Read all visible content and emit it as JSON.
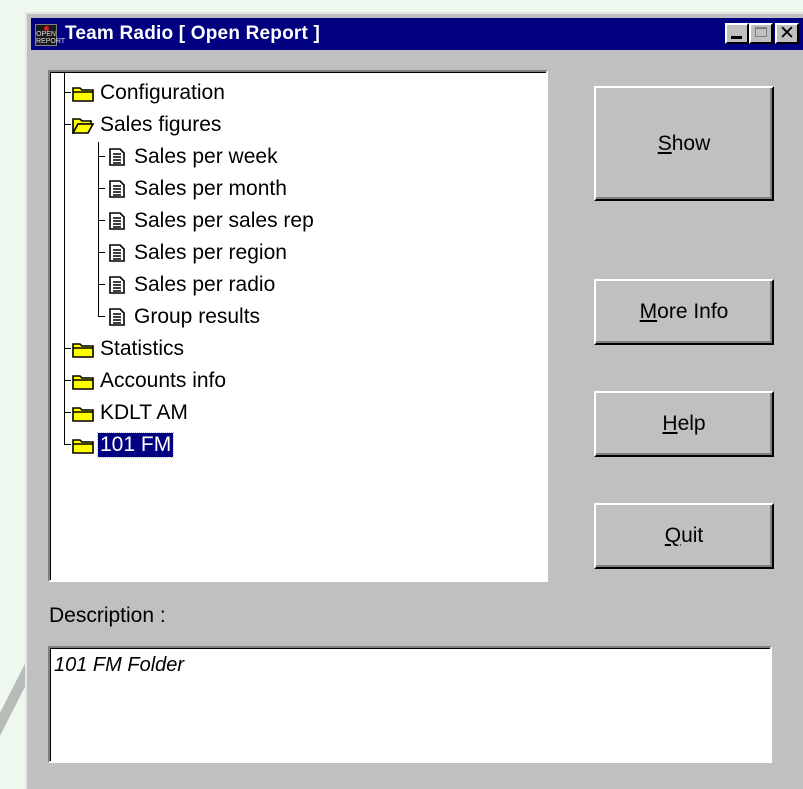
{
  "window": {
    "title": "Team Radio [ Open Report ]",
    "app_icon_text": "OPEN REPORT"
  },
  "tree": {
    "items": [
      {
        "label": "Configuration",
        "icon": "folder-closed-icon",
        "level": 0
      },
      {
        "label": "Sales figures",
        "icon": "folder-open-icon",
        "level": 0
      },
      {
        "label": "Sales per week",
        "icon": "report-document-icon",
        "level": 1
      },
      {
        "label": "Sales per month",
        "icon": "report-document-icon",
        "level": 1
      },
      {
        "label": "Sales per sales rep",
        "icon": "report-document-icon",
        "level": 1
      },
      {
        "label": "Sales per region",
        "icon": "report-document-icon",
        "level": 1
      },
      {
        "label": "Sales per radio",
        "icon": "report-document-icon",
        "level": 1
      },
      {
        "label": "Group results",
        "icon": "report-document-icon",
        "level": 1
      },
      {
        "label": "Statistics",
        "icon": "folder-closed-icon",
        "level": 0
      },
      {
        "label": "Accounts info",
        "icon": "folder-closed-icon",
        "level": 0
      },
      {
        "label": "KDLT AM",
        "icon": "folder-closed-icon",
        "level": 0
      },
      {
        "label": "101 FM",
        "icon": "folder-closed-icon",
        "level": 0,
        "selected": true
      }
    ]
  },
  "buttons": {
    "show": {
      "first": "S",
      "rest": "how"
    },
    "more_info": {
      "first": "M",
      "rest": "ore Info"
    },
    "help": {
      "first": "H",
      "rest": "elp"
    },
    "quit": {
      "first": "Q",
      "rest": "uit"
    }
  },
  "description": {
    "label": "Description :",
    "text": "101 FM Folder"
  },
  "colors": {
    "titlebar": "#000080",
    "selection": "#000080",
    "face": "#c0c0c0",
    "folder": "#ffff00"
  }
}
